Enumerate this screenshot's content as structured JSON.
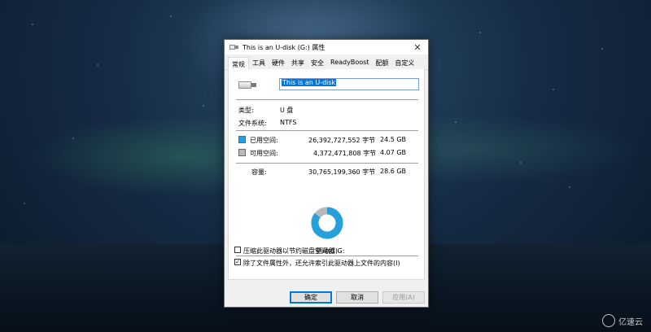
{
  "window": {
    "title": "This is an U-disk (G:) 属性",
    "close_glyph": "✕"
  },
  "tabs": [
    {
      "label": "常规",
      "active": true
    },
    {
      "label": "工具",
      "active": false
    },
    {
      "label": "硬件",
      "active": false
    },
    {
      "label": "共享",
      "active": false
    },
    {
      "label": "安全",
      "active": false
    },
    {
      "label": "ReadyBoost",
      "active": false
    },
    {
      "label": "配额",
      "active": false
    },
    {
      "label": "自定义",
      "active": false
    }
  ],
  "general": {
    "drive_name": "This is an U-disk",
    "type_label": "类型:",
    "type_value": "U 盘",
    "fs_label": "文件系统:",
    "fs_value": "NTFS",
    "used_label": "已用空间:",
    "used_bytes": "26,392,727,552 字节",
    "used_size": "24.5 GB",
    "free_label": "可用空间:",
    "free_bytes": "4,372,471,808 字节",
    "free_size": "4.07 GB",
    "capacity_label": "容量:",
    "capacity_bytes": "30,765,199,360 字节",
    "capacity_size": "28.6 GB",
    "drive_caption": "驱动器 G:",
    "compress_label": "压缩此驱动器以节约磁盘空间(C)",
    "compress_checked": false,
    "index_label": "除了文件属性外，还允许索引此驱动器上文件的内容(I)",
    "index_checked": true,
    "check_glyph": "✓"
  },
  "chart_data": {
    "type": "pie",
    "categories": [
      "已用空间",
      "可用空间"
    ],
    "values": [
      26392727552,
      4372471808
    ],
    "colors": [
      "#26a0da",
      "#b9b9b9"
    ]
  },
  "buttons": {
    "ok": "确定",
    "cancel": "取消",
    "apply": "应用(A)"
  },
  "watermark": {
    "text": "亿速云"
  }
}
